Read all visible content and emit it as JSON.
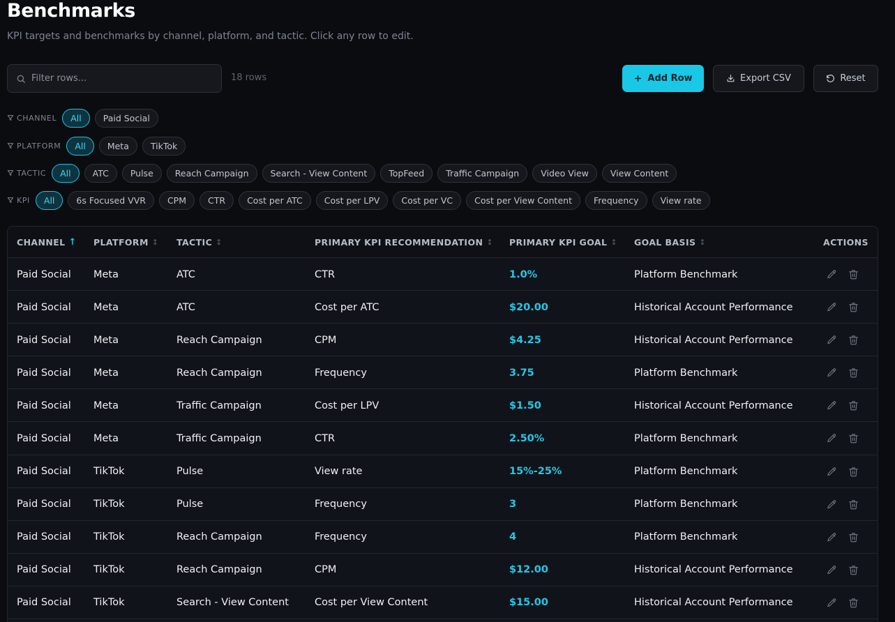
{
  "header": {
    "title": "Benchmarks",
    "subtitle": "KPI targets and benchmarks by channel, platform, and tactic. Click any row to edit."
  },
  "toolbar": {
    "search_placeholder": "Filter rows...",
    "row_count": "18 rows",
    "add_label": "Add Row",
    "export_label": "Export CSV",
    "reset_label": "Reset"
  },
  "filters": {
    "channel": {
      "label": "CHANNEL",
      "chips": [
        "All",
        "Paid Social"
      ],
      "active": "All"
    },
    "platform": {
      "label": "PLATFORM",
      "chips": [
        "All",
        "Meta",
        "TikTok"
      ],
      "active": "All"
    },
    "tactic": {
      "label": "TACTIC",
      "chips": [
        "All",
        "ATC",
        "Pulse",
        "Reach Campaign",
        "Search - View Content",
        "TopFeed",
        "Traffic Campaign",
        "Video View",
        "View Content"
      ],
      "active": "All"
    },
    "kpi": {
      "label": "KPI",
      "chips": [
        "All",
        "6s Focused VVR",
        "CPM",
        "CTR",
        "Cost per ATC",
        "Cost per LPV",
        "Cost per VC",
        "Cost per View Content",
        "Frequency",
        "View rate"
      ],
      "active": "All"
    }
  },
  "table": {
    "columns": [
      "CHANNEL",
      "PLATFORM",
      "TACTIC",
      "PRIMARY KPI RECOMMENDATION",
      "PRIMARY KPI GOAL",
      "GOAL BASIS",
      "ACTIONS"
    ],
    "sort_column": "CHANNEL",
    "sort_direction": "ascending",
    "rows": [
      [
        "Paid Social",
        "Meta",
        "ATC",
        "CTR",
        "1.0%",
        "Platform Benchmark"
      ],
      [
        "Paid Social",
        "Meta",
        "ATC",
        "Cost per ATC",
        "$20.00",
        "Historical Account Performance"
      ],
      [
        "Paid Social",
        "Meta",
        "Reach Campaign",
        "CPM",
        "$4.25",
        "Historical Account Performance"
      ],
      [
        "Paid Social",
        "Meta",
        "Reach Campaign",
        "Frequency",
        "3.75",
        "Platform Benchmark"
      ],
      [
        "Paid Social",
        "Meta",
        "Traffic Campaign",
        "Cost per LPV",
        "$1.50",
        "Historical Account Performance"
      ],
      [
        "Paid Social",
        "Meta",
        "Traffic Campaign",
        "CTR",
        "2.50%",
        "Platform Benchmark"
      ],
      [
        "Paid Social",
        "TikTok",
        "Pulse",
        "View rate",
        "15%-25%",
        "Platform Benchmark"
      ],
      [
        "Paid Social",
        "TikTok",
        "Pulse",
        "Frequency",
        "3",
        "Platform Benchmark"
      ],
      [
        "Paid Social",
        "TikTok",
        "Reach Campaign",
        "Frequency",
        "4",
        "Platform Benchmark"
      ],
      [
        "Paid Social",
        "TikTok",
        "Reach Campaign",
        "CPM",
        "$12.00",
        "Historical Account Performance"
      ],
      [
        "Paid Social",
        "TikTok",
        "Search - View Content",
        "Cost per View Content",
        "$15.00",
        "Historical Account Performance"
      ]
    ]
  },
  "icons": {
    "search": "search-icon",
    "add": "plus-icon",
    "export": "download-icon",
    "reset": "rotate-ccw-icon",
    "filter": "filter-icon",
    "edit": "pencil-icon",
    "delete": "trash-icon"
  },
  "colors": {
    "accent": "#19c8e6",
    "background": "#0b0c10",
    "goal_text": "#24c8e6"
  }
}
